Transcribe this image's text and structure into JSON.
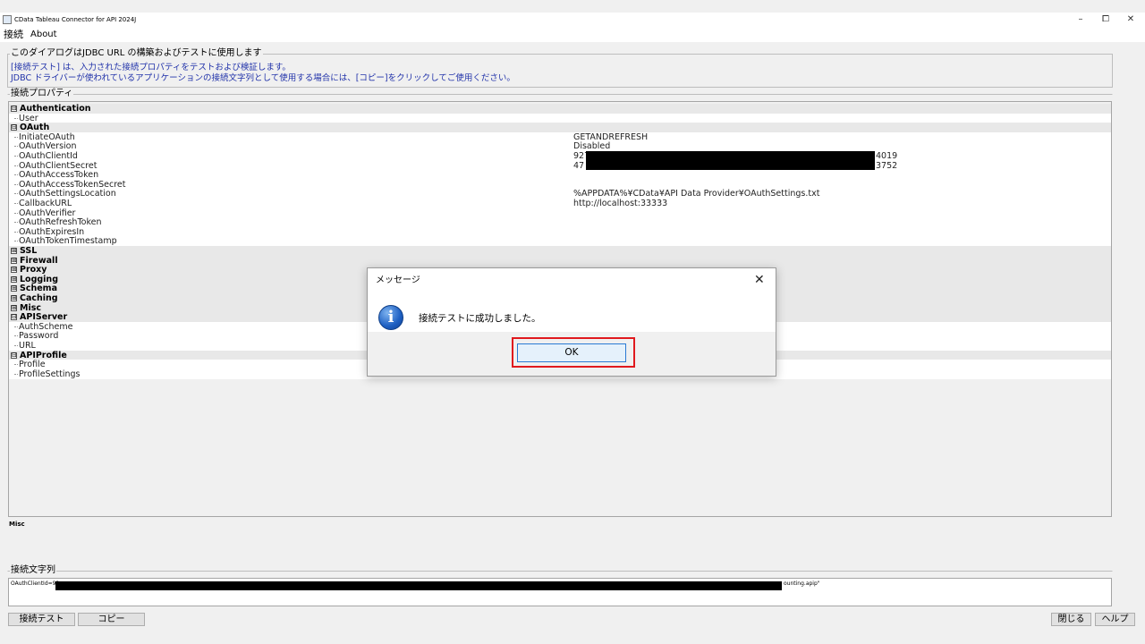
{
  "window": {
    "title": "CData Tableau Connector for API 2024J",
    "minimize_glyph": "–",
    "maximize_glyph": "⧠",
    "close_glyph": "✕"
  },
  "menu": {
    "items": [
      "接続",
      "About"
    ]
  },
  "description": {
    "title": "このダイアログはJDBC URL の構築およびテストに使用します",
    "lines": [
      "[接続テスト] は、入力された接続プロパティをテストおよび検証します。",
      "JDBC ドライバーが使われているアプリケーションの接続文字列として使用する場合には、[コピー]をクリックしてご使用ください。"
    ]
  },
  "properties": {
    "title": "接続プロパティ",
    "expanded_glyph": "⊟",
    "collapsed_glyph": "⊞",
    "rows": [
      {
        "type": "category",
        "label": "Authentication",
        "expanded": true
      },
      {
        "type": "property",
        "label": "User",
        "value": ""
      },
      {
        "type": "category",
        "label": "OAuth",
        "expanded": true
      },
      {
        "type": "property",
        "label": "InitiateOAuth",
        "value": "GETANDREFRESH"
      },
      {
        "type": "property",
        "label": "OAuthVersion",
        "value": "Disabled"
      },
      {
        "type": "property",
        "label": "OAuthClientId",
        "value": "927",
        "value_tail": "4019"
      },
      {
        "type": "property",
        "label": "OAuthClientSecret",
        "value": "47",
        "value_tail": "3752"
      },
      {
        "type": "property",
        "label": "OAuthAccessToken",
        "value": ""
      },
      {
        "type": "property",
        "label": "OAuthAccessTokenSecret",
        "value": ""
      },
      {
        "type": "property",
        "label": "OAuthSettingsLocation",
        "value": "%APPDATA%¥CData¥API Data Provider¥OAuthSettings.txt"
      },
      {
        "type": "property",
        "label": "CallbackURL",
        "value": "http://localhost:33333"
      },
      {
        "type": "property",
        "label": "OAuthVerifier",
        "value": ""
      },
      {
        "type": "property",
        "label": "OAuthRefreshToken",
        "value": ""
      },
      {
        "type": "property",
        "label": "OAuthExpiresIn",
        "value": ""
      },
      {
        "type": "property",
        "label": "OAuthTokenTimestamp",
        "value": ""
      },
      {
        "type": "category",
        "label": "SSL",
        "expanded": false
      },
      {
        "type": "category",
        "label": "Firewall",
        "expanded": false
      },
      {
        "type": "category",
        "label": "Proxy",
        "expanded": false
      },
      {
        "type": "category",
        "label": "Logging",
        "expanded": false
      },
      {
        "type": "category",
        "label": "Schema",
        "expanded": false
      },
      {
        "type": "category",
        "label": "Caching",
        "expanded": false
      },
      {
        "type": "category",
        "label": "Misc",
        "expanded": false
      },
      {
        "type": "category",
        "label": "APIServer",
        "expanded": true
      },
      {
        "type": "property",
        "label": "AuthScheme",
        "value": ""
      },
      {
        "type": "property",
        "label": "Password",
        "value": ""
      },
      {
        "type": "property",
        "label": "URL",
        "value": ""
      },
      {
        "type": "category",
        "label": "APIProfile",
        "expanded": true
      },
      {
        "type": "property",
        "label": "Profile",
        "value": ""
      },
      {
        "type": "property",
        "label": "ProfileSettings",
        "value": ""
      }
    ]
  },
  "selected_category": "Misc",
  "connection_string": {
    "title": "接続文字列",
    "prefix": "OAuthClientId=92",
    "suffix": "ounting.apip\""
  },
  "buttons": {
    "test": "接続テスト",
    "copy": "コピー",
    "close": "閉じる",
    "help": "ヘルプ"
  },
  "dialog": {
    "title": "メッセージ",
    "close_glyph": "✕",
    "icon": "info-icon",
    "icon_glyph": "i",
    "message": "接続テストに成功しました。",
    "ok_label": "OK",
    "highlight_color": "#e0191e"
  }
}
